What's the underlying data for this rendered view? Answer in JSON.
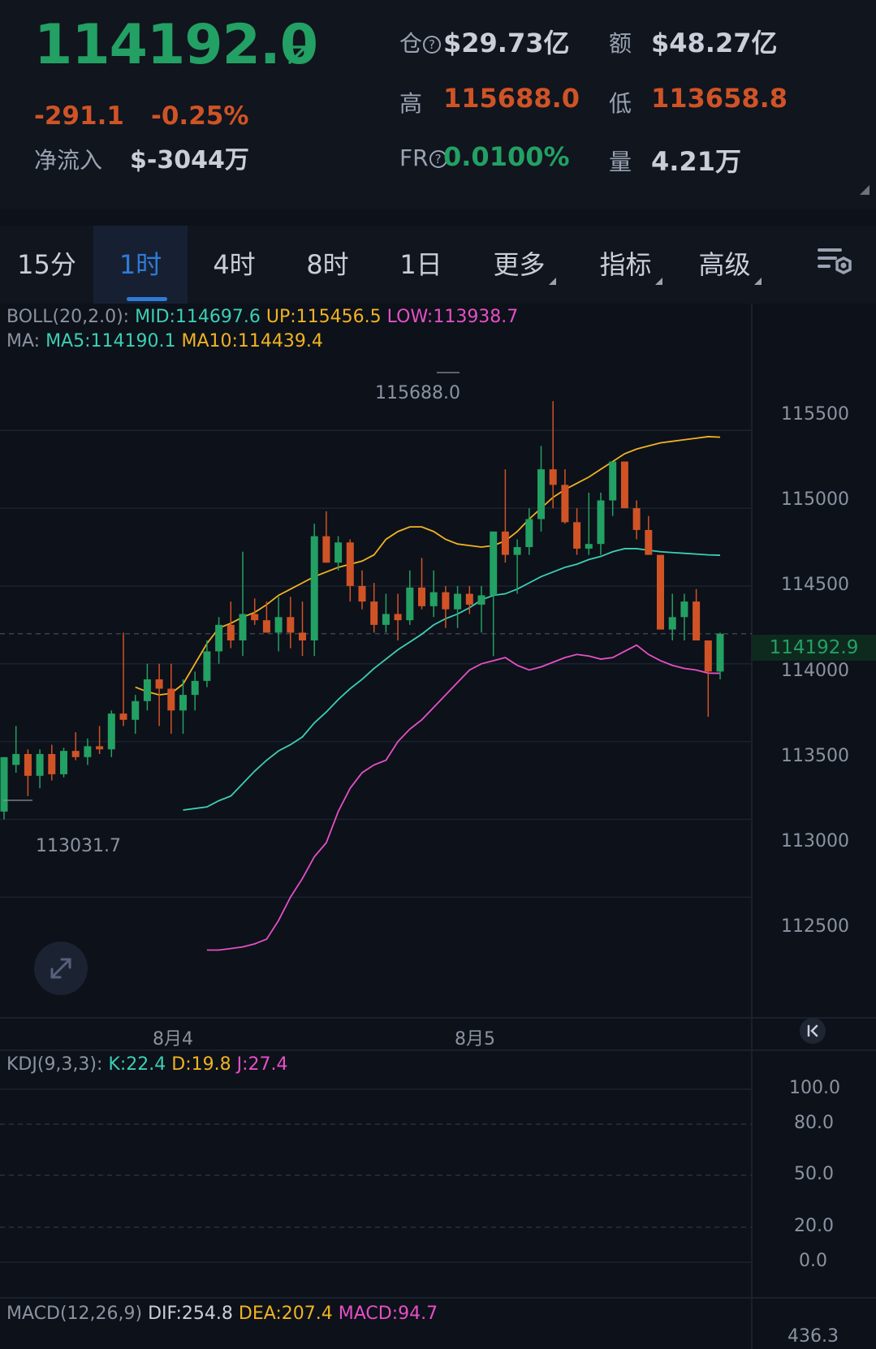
{
  "header": {
    "price": "114192.0",
    "change_abs": "-291.1",
    "change_pct": "-0.25%",
    "netflow_label": "净流入",
    "netflow_value": "$-3044万",
    "oi_label": "仓",
    "oi_value": "$29.73亿",
    "amount_label": "额",
    "amount_value": "$48.27亿",
    "high_label": "高",
    "high_value": "115688.0",
    "low_label": "低",
    "low_value": "113658.8",
    "fr_label": "FR",
    "fr_value": "0.0100%",
    "volume_label": "量",
    "volume_value": "4.21万",
    "help_glyph": "?",
    "arrow_icon": "arrow-up-right-icon"
  },
  "tabs": [
    {
      "label": "15分",
      "active": false
    },
    {
      "label": "1时",
      "active": true
    },
    {
      "label": "4时",
      "active": false
    },
    {
      "label": "8时",
      "active": false
    },
    {
      "label": "1日",
      "active": false
    },
    {
      "label": "更多",
      "active": false
    },
    {
      "label": "指标",
      "active": false
    },
    {
      "label": "高级",
      "active": false
    }
  ],
  "indicators": {
    "boll_name": "BOLL(20,2.0):",
    "boll_mid": "MID:114697.6",
    "boll_up": "UP:115456.5",
    "boll_low": "LOW:113938.7",
    "ma_name": "MA:",
    "ma5": "MA5:114190.1",
    "ma10": "MA10:114439.4",
    "kdj_name": "KDJ(9,3,3):",
    "kdj_k": "K:22.4",
    "kdj_d": "D:19.8",
    "kdj_j": "J:27.4",
    "macd_name": "MACD(12,26,9)",
    "macd_dif": "DIF:254.8",
    "macd_dea": "DEA:207.4",
    "macd_macd": "MACD:94.7"
  },
  "price_axis": [
    "115500",
    "115000",
    "114500",
    "114000",
    "113500",
    "113000",
    "112500"
  ],
  "current_price_tag": "114192.9",
  "high_marker": "115688.0",
  "low_marker": "113031.7",
  "time_axis": [
    "8月4",
    "8月5"
  ],
  "kdj_axis": [
    "100.0",
    "80.0",
    "50.0",
    "20.0",
    "0.0"
  ],
  "macd_axis_top": "436.3",
  "colors": {
    "up": "#23a063",
    "down": "#d05326",
    "teal": "#3ccfb6",
    "orange": "#f0b323",
    "pink": "#e550c7",
    "bg": "#0d1119"
  },
  "chart_data": {
    "type": "candlestick",
    "y_range": [
      112100,
      115950
    ],
    "candles": [
      {
        "o": 113050,
        "h": 113400,
        "l": 113000,
        "c": 113400
      },
      {
        "o": 113350,
        "h": 113600,
        "l": 113300,
        "c": 113420
      },
      {
        "o": 113420,
        "h": 113450,
        "l": 113150,
        "c": 113280
      },
      {
        "o": 113280,
        "h": 113450,
        "l": 113200,
        "c": 113420
      },
      {
        "o": 113420,
        "h": 113480,
        "l": 113250,
        "c": 113290
      },
      {
        "o": 113290,
        "h": 113460,
        "l": 113270,
        "c": 113440
      },
      {
        "o": 113440,
        "h": 113560,
        "l": 113380,
        "c": 113400
      },
      {
        "o": 113400,
        "h": 113520,
        "l": 113350,
        "c": 113470
      },
      {
        "o": 113470,
        "h": 113600,
        "l": 113420,
        "c": 113450
      },
      {
        "o": 113450,
        "h": 113700,
        "l": 113400,
        "c": 113680
      },
      {
        "o": 113680,
        "h": 114200,
        "l": 113600,
        "c": 113640
      },
      {
        "o": 113640,
        "h": 113800,
        "l": 113550,
        "c": 113760
      },
      {
        "o": 113760,
        "h": 114000,
        "l": 113700,
        "c": 113900
      },
      {
        "o": 113900,
        "h": 114000,
        "l": 113600,
        "c": 113840
      },
      {
        "o": 113840,
        "h": 114000,
        "l": 113550,
        "c": 113700
      },
      {
        "o": 113700,
        "h": 113900,
        "l": 113550,
        "c": 113800
      },
      {
        "o": 113800,
        "h": 113950,
        "l": 113700,
        "c": 113890
      },
      {
        "o": 113890,
        "h": 114150,
        "l": 113850,
        "c": 114080
      },
      {
        "o": 114080,
        "h": 114300,
        "l": 114000,
        "c": 114250
      },
      {
        "o": 114250,
        "h": 114400,
        "l": 114100,
        "c": 114150
      },
      {
        "o": 114150,
        "h": 114720,
        "l": 114050,
        "c": 114320
      },
      {
        "o": 114320,
        "h": 114420,
        "l": 114250,
        "c": 114280
      },
      {
        "o": 114280,
        "h": 114400,
        "l": 114200,
        "c": 114200
      },
      {
        "o": 114200,
        "h": 114430,
        "l": 114080,
        "c": 114300
      },
      {
        "o": 114300,
        "h": 114430,
        "l": 114100,
        "c": 114200
      },
      {
        "o": 114200,
        "h": 114400,
        "l": 114050,
        "c": 114150
      },
      {
        "o": 114150,
        "h": 114900,
        "l": 114050,
        "c": 114820
      },
      {
        "o": 114820,
        "h": 114980,
        "l": 114650,
        "c": 114650
      },
      {
        "o": 114650,
        "h": 114820,
        "l": 114600,
        "c": 114780
      },
      {
        "o": 114780,
        "h": 114800,
        "l": 114400,
        "c": 114500
      },
      {
        "o": 114500,
        "h": 114600,
        "l": 114350,
        "c": 114400
      },
      {
        "o": 114400,
        "h": 114520,
        "l": 114200,
        "c": 114250
      },
      {
        "o": 114250,
        "h": 114450,
        "l": 114200,
        "c": 114320
      },
      {
        "o": 114320,
        "h": 114450,
        "l": 114150,
        "c": 114280
      },
      {
        "o": 114280,
        "h": 114600,
        "l": 114250,
        "c": 114490
      },
      {
        "o": 114490,
        "h": 114680,
        "l": 114350,
        "c": 114370
      },
      {
        "o": 114370,
        "h": 114600,
        "l": 114300,
        "c": 114460
      },
      {
        "o": 114460,
        "h": 114500,
        "l": 114230,
        "c": 114350
      },
      {
        "o": 114350,
        "h": 114500,
        "l": 114230,
        "c": 114450
      },
      {
        "o": 114450,
        "h": 114500,
        "l": 114320,
        "c": 114380
      },
      {
        "o": 114380,
        "h": 114500,
        "l": 114200,
        "c": 114440
      },
      {
        "o": 114440,
        "h": 114850,
        "l": 114050,
        "c": 114850
      },
      {
        "o": 114850,
        "h": 115250,
        "l": 114650,
        "c": 114700
      },
      {
        "o": 114700,
        "h": 114800,
        "l": 114450,
        "c": 114750
      },
      {
        "o": 114750,
        "h": 115000,
        "l": 114700,
        "c": 114930
      },
      {
        "o": 114930,
        "h": 115400,
        "l": 114850,
        "c": 115250
      },
      {
        "o": 115250,
        "h": 115688,
        "l": 115000,
        "c": 115150
      },
      {
        "o": 115150,
        "h": 115250,
        "l": 114900,
        "c": 114910
      },
      {
        "o": 114910,
        "h": 115000,
        "l": 114700,
        "c": 114740
      },
      {
        "o": 114740,
        "h": 115100,
        "l": 114700,
        "c": 114770
      },
      {
        "o": 114770,
        "h": 115100,
        "l": 114700,
        "c": 115050
      },
      {
        "o": 115050,
        "h": 115300,
        "l": 114950,
        "c": 115300
      },
      {
        "o": 115300,
        "h": 115300,
        "l": 115000,
        "c": 115000
      },
      {
        "o": 115000,
        "h": 115050,
        "l": 114800,
        "c": 114860
      },
      {
        "o": 114860,
        "h": 114950,
        "l": 114700,
        "c": 114700
      },
      {
        "o": 114700,
        "h": 114700,
        "l": 114400,
        "c": 114220
      },
      {
        "o": 114220,
        "h": 114450,
        "l": 114150,
        "c": 114300
      },
      {
        "o": 114300,
        "h": 114450,
        "l": 114150,
        "c": 114400
      },
      {
        "o": 114400,
        "h": 114480,
        "l": 114150,
        "c": 114150
      },
      {
        "o": 114150,
        "h": 114150,
        "l": 113658.8,
        "c": 113950
      },
      {
        "o": 113950,
        "h": 114200,
        "l": 113900,
        "c": 114192.9
      }
    ],
    "boll_up": [
      113850,
      113820,
      113800,
      113810,
      113870,
      114000,
      114130,
      114230,
      114260,
      114300,
      114330,
      114380,
      114440,
      114480,
      114520,
      114560,
      114590,
      114620,
      114640,
      114660,
      114700,
      114800,
      114850,
      114880,
      114880,
      114850,
      114800,
      114770,
      114760,
      114750,
      114760,
      114790,
      114850,
      114930,
      115000,
      115070,
      115120,
      115160,
      115200,
      115250,
      115300,
      115350,
      115380,
      115400,
      115420,
      115430,
      115440,
      115450,
      115460,
      115456.5
    ],
    "boll_mid": [
      113060,
      113070,
      113080,
      113120,
      113150,
      113230,
      113310,
      113380,
      113440,
      113480,
      113530,
      113620,
      113690,
      113770,
      113840,
      113900,
      113970,
      114030,
      114090,
      114140,
      114190,
      114250,
      114290,
      114320,
      114360,
      114410,
      114440,
      114450,
      114480,
      114520,
      114560,
      114590,
      114620,
      114640,
      114670,
      114690,
      114720,
      114740,
      114740,
      114730,
      114720,
      114715,
      114710,
      114705,
      114700,
      114697.6
    ],
    "boll_low": [
      112160,
      112160,
      112170,
      112180,
      112200,
      112230,
      112350,
      112500,
      112620,
      112760,
      112850,
      113050,
      113200,
      113300,
      113350,
      113380,
      113500,
      113580,
      113640,
      113720,
      113800,
      113880,
      113960,
      114000,
      114020,
      114040,
      113990,
      113960,
      113980,
      114010,
      114040,
      114060,
      114050,
      114030,
      114040,
      114080,
      114120,
      114060,
      114020,
      113990,
      113970,
      113960,
      113940,
      113938.7
    ]
  }
}
